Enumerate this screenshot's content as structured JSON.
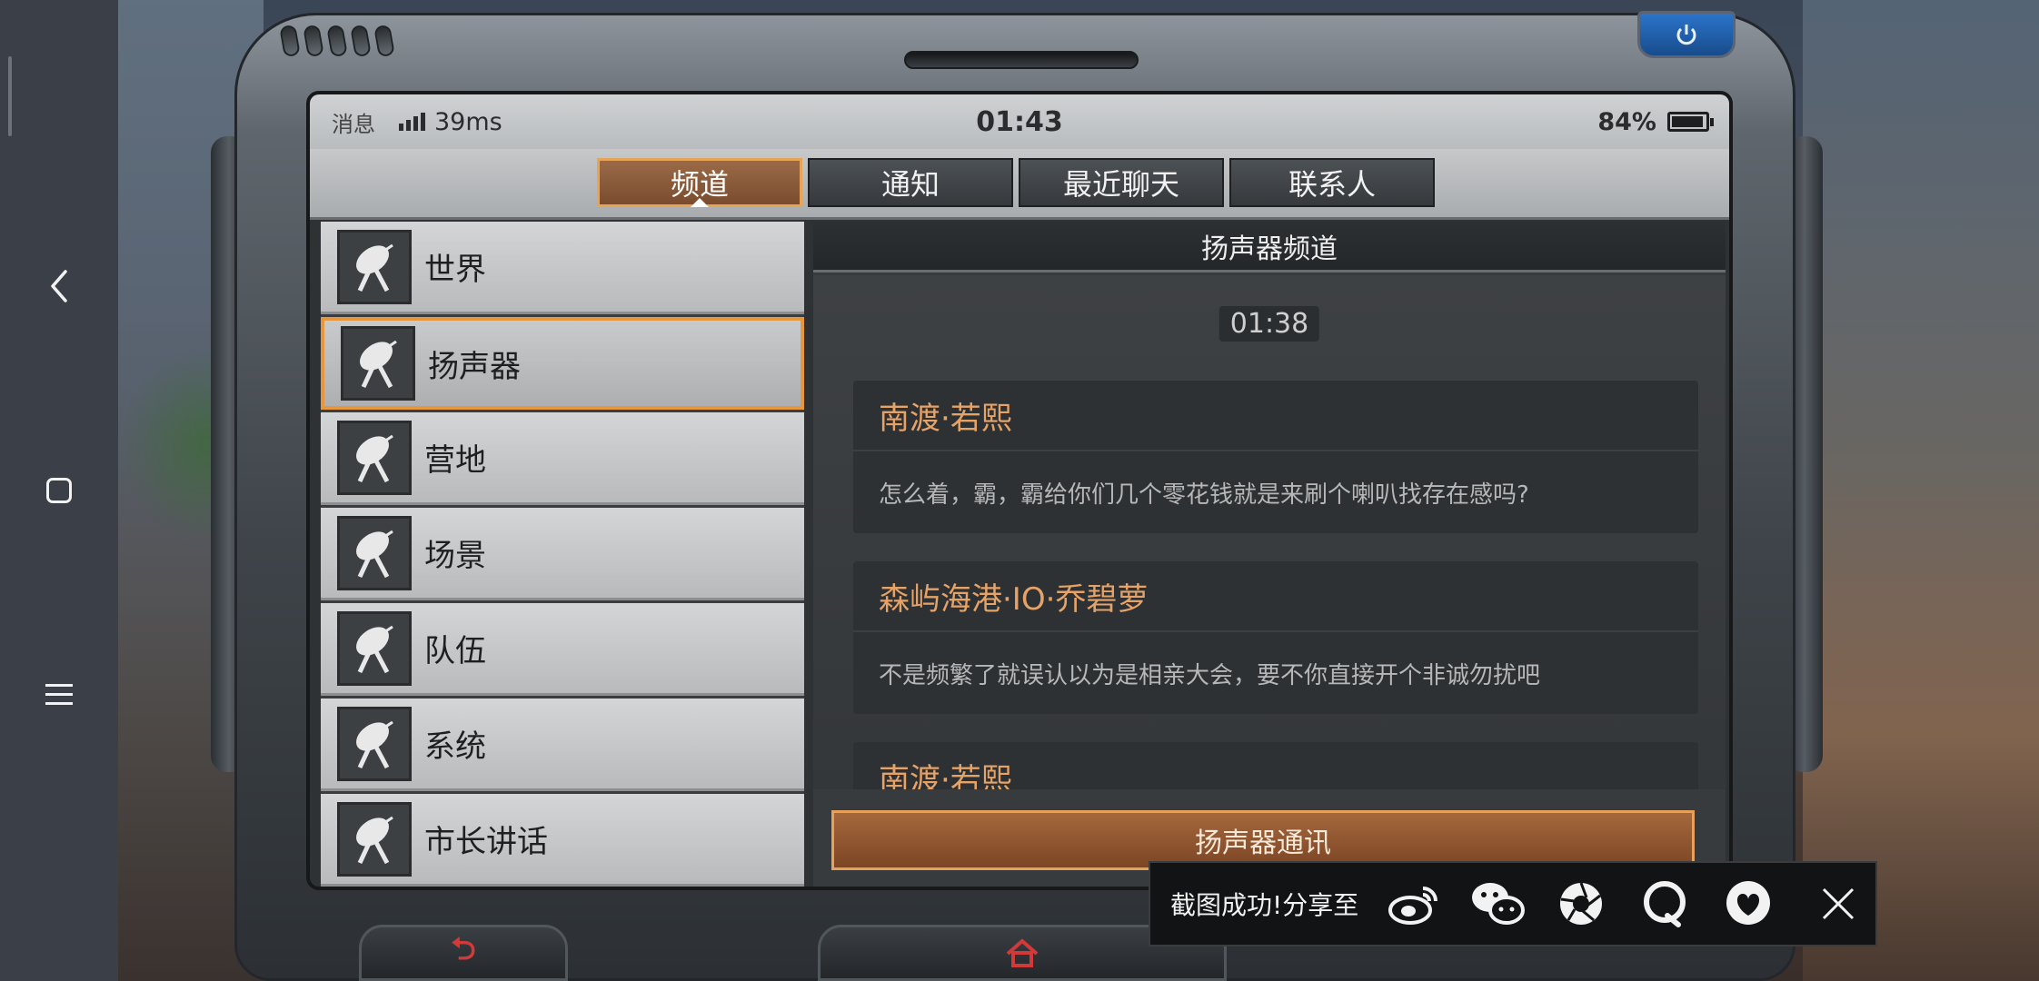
{
  "status_bar": {
    "label": "消息",
    "ping": "39ms",
    "time": "01:43",
    "battery": "84%"
  },
  "tabs": [
    {
      "label": "频道",
      "active": true
    },
    {
      "label": "通知",
      "active": false
    },
    {
      "label": "最近聊天",
      "active": false
    },
    {
      "label": "联系人",
      "active": false
    }
  ],
  "channels": [
    {
      "label": "世界",
      "icon": "satellite-dish-icon",
      "active": false
    },
    {
      "label": "扬声器",
      "icon": "satellite-dish-icon",
      "active": true
    },
    {
      "label": "营地",
      "icon": "satellite-dish-icon",
      "active": false
    },
    {
      "label": "场景",
      "icon": "satellite-dish-icon",
      "active": false
    },
    {
      "label": "队伍",
      "icon": "satellite-dish-icon",
      "active": false
    },
    {
      "label": "系统",
      "icon": "satellite-dish-icon",
      "active": false
    },
    {
      "label": "市长讲话",
      "icon": "satellite-dish-icon",
      "active": false
    }
  ],
  "panel": {
    "title": "扬声器频道",
    "timestamp": "01:38",
    "messages": [
      {
        "sender": "南渡·若熙",
        "text": "怎么着，霸，霸给你们几个零花钱就是来刷个喇叭找存在感吗?"
      },
      {
        "sender": "森屿海港·IO·乔碧萝",
        "text": "不是频繁了就误认以为是相亲大会，要不你直接开个非诚勿扰吧"
      },
      {
        "sender": "南渡·若熙",
        "text": ""
      }
    ],
    "send_button": "扬声器通讯"
  },
  "share_toast": {
    "text": "截图成功!分享至",
    "targets": [
      "weibo-icon",
      "wechat-icon",
      "moments-icon",
      "qq-icon",
      "qzone-icon"
    ]
  },
  "colors": {
    "accent": "#e8963c",
    "sender_name": "#e5a368",
    "power_button": "#2b74c9",
    "device_back_glyph": "#d23a3a"
  }
}
